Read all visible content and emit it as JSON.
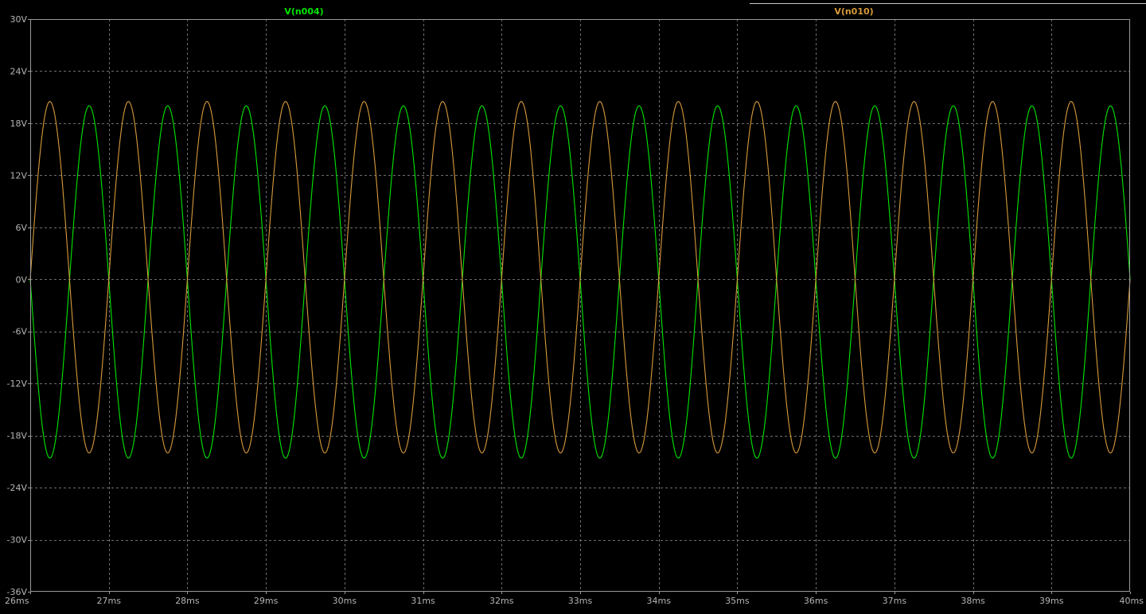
{
  "chart_data": {
    "type": "line",
    "xlim": [
      26,
      40
    ],
    "ylim": [
      -36,
      30
    ],
    "x_ticks": [
      26,
      27,
      28,
      29,
      30,
      31,
      32,
      33,
      34,
      35,
      36,
      37,
      38,
      39,
      40
    ],
    "x_tick_labels": [
      "26ms",
      "27ms",
      "28ms",
      "29ms",
      "30ms",
      "31ms",
      "32ms",
      "33ms",
      "34ms",
      "35ms",
      "36ms",
      "37ms",
      "38ms",
      "39ms",
      "40ms"
    ],
    "y_ticks": [
      30,
      24,
      18,
      12,
      6,
      0,
      -6,
      -12,
      -18,
      -24,
      -30,
      -36
    ],
    "y_tick_labels": [
      "30V",
      "24V",
      "18V",
      "12V",
      "6V",
      "0V",
      "-6V",
      "-12V",
      "-18V",
      "-24V",
      "-30V",
      "-36V"
    ],
    "grid": true,
    "legend_placement": "top",
    "background_color": "#000000",
    "series": [
      {
        "name": "V(n004)",
        "color": "#00e600",
        "x_unit": "ms",
        "y_unit": "V",
        "frequency_hz": 1000,
        "phase_deg": 180,
        "peaks": [
          {
            "x": 26.25,
            "y": -20.6
          },
          {
            "x": 26.75,
            "y": 20.0
          },
          {
            "x": 27.25,
            "y": -20.6
          },
          {
            "x": 27.75,
            "y": 20.0
          },
          {
            "x": 28.25,
            "y": -20.6
          },
          {
            "x": 28.75,
            "y": 20.0
          },
          {
            "x": 29.25,
            "y": -20.6
          },
          {
            "x": 29.75,
            "y": 20.0
          },
          {
            "x": 30.25,
            "y": -20.6
          },
          {
            "x": 30.75,
            "y": 20.0
          },
          {
            "x": 31.25,
            "y": -20.6
          },
          {
            "x": 31.75,
            "y": 20.0
          },
          {
            "x": 32.25,
            "y": -20.6
          },
          {
            "x": 32.75,
            "y": 20.0
          },
          {
            "x": 33.25,
            "y": -20.6
          },
          {
            "x": 33.75,
            "y": 20.0
          },
          {
            "x": 34.25,
            "y": -20.6
          },
          {
            "x": 34.75,
            "y": 20.0
          },
          {
            "x": 35.25,
            "y": -20.6
          },
          {
            "x": 35.75,
            "y": 20.0
          },
          {
            "x": 36.25,
            "y": -20.6
          },
          {
            "x": 36.75,
            "y": 20.0
          },
          {
            "x": 37.25,
            "y": -20.6
          },
          {
            "x": 37.75,
            "y": 20.0
          },
          {
            "x": 38.25,
            "y": -20.6
          },
          {
            "x": 38.75,
            "y": 20.0
          },
          {
            "x": 39.25,
            "y": -20.6
          },
          {
            "x": 39.75,
            "y": 20.0
          }
        ]
      },
      {
        "name": "V(n010)",
        "color": "#d89a3c",
        "x_unit": "ms",
        "y_unit": "V",
        "frequency_hz": 1000,
        "phase_deg": 0,
        "peaks": [
          {
            "x": 26.25,
            "y": 20.5
          },
          {
            "x": 26.75,
            "y": -20.0
          },
          {
            "x": 27.25,
            "y": 20.5
          },
          {
            "x": 27.75,
            "y": -20.0
          },
          {
            "x": 28.25,
            "y": 20.5
          },
          {
            "x": 28.75,
            "y": -20.0
          },
          {
            "x": 29.25,
            "y": 20.5
          },
          {
            "x": 29.75,
            "y": -20.0
          },
          {
            "x": 30.25,
            "y": 20.5
          },
          {
            "x": 30.75,
            "y": -20.0
          },
          {
            "x": 31.25,
            "y": 20.5
          },
          {
            "x": 31.75,
            "y": -20.0
          },
          {
            "x": 32.25,
            "y": 20.5
          },
          {
            "x": 32.75,
            "y": -20.0
          },
          {
            "x": 33.25,
            "y": 20.5
          },
          {
            "x": 33.75,
            "y": -20.0
          },
          {
            "x": 34.25,
            "y": 20.5
          },
          {
            "x": 34.75,
            "y": -20.0
          },
          {
            "x": 35.25,
            "y": 20.5
          },
          {
            "x": 35.75,
            "y": -20.0
          },
          {
            "x": 36.25,
            "y": 20.5
          },
          {
            "x": 36.75,
            "y": -20.0
          },
          {
            "x": 37.25,
            "y": 20.5
          },
          {
            "x": 37.75,
            "y": -20.0
          },
          {
            "x": 38.25,
            "y": 20.5
          },
          {
            "x": 38.75,
            "y": -20.0
          },
          {
            "x": 39.25,
            "y": 20.5
          },
          {
            "x": 39.75,
            "y": -20.0
          }
        ]
      }
    ]
  }
}
